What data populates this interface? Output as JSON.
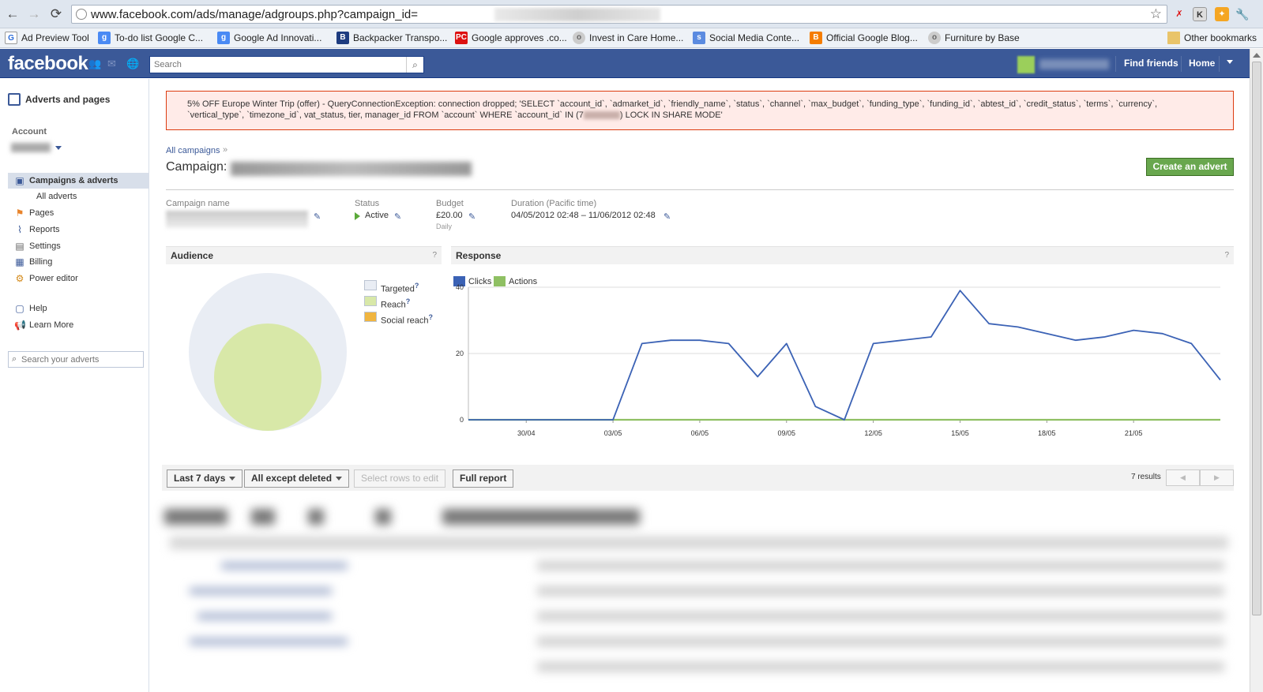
{
  "browser": {
    "back": "←",
    "forward": "→",
    "reload": "⟳",
    "url": "www.facebook.com/ads/manage/adgroups.php?campaign_id=",
    "bookmarks": [
      {
        "label": "Ad Preview Tool",
        "icon": "G"
      },
      {
        "label": "To-do list Google C...",
        "icon": "g"
      },
      {
        "label": "Google Ad Innovati...",
        "icon": "g"
      },
      {
        "label": "Backpacker Transpo...",
        "icon": "B"
      },
      {
        "label": "Google approves .co...",
        "icon": "PC"
      },
      {
        "label": "Invest in Care Home...",
        "icon": "o"
      },
      {
        "label": "Social Media Conte...",
        "icon": "s"
      },
      {
        "label": "Official Google Blog...",
        "icon": "B"
      },
      {
        "label": "Furniture by Base",
        "icon": "o"
      }
    ],
    "other_bookmarks": "Other bookmarks"
  },
  "header": {
    "logo": "facebook",
    "search_placeholder": "Search",
    "find_friends": "Find friends",
    "home": "Home"
  },
  "sidebar": {
    "title": "Adverts and pages",
    "account_label": "Account",
    "items": [
      {
        "label": "Campaigns & adverts",
        "icon": "campaigns-icon"
      },
      {
        "label": "All adverts",
        "icon": ""
      },
      {
        "label": "Pages",
        "icon": "flag-icon"
      },
      {
        "label": "Reports",
        "icon": "reports-icon"
      },
      {
        "label": "Settings",
        "icon": "settings-icon"
      },
      {
        "label": "Billing",
        "icon": "billing-icon"
      },
      {
        "label": "Power editor",
        "icon": "power-editor-icon"
      },
      {
        "label": "Help",
        "icon": "help-icon"
      },
      {
        "label": "Learn More",
        "icon": "megaphone-icon"
      }
    ],
    "search_placeholder": "Search your adverts"
  },
  "error": {
    "text": "5% OFF Europe Winter Trip (offer) - QueryConnectionException: connection dropped; 'SELECT `account_id`, `admarket_id`, `friendly_name`, `status`, `channel`, `max_budget`, `funding_type`, `funding_id`, `abtest_id`, `credit_status`, `terms`, `currency`, `vertical_type`, `timezone_id`, vat_status, tier, manager_id FROM `account` WHERE `account_id` IN (7",
    "text_end": ") LOCK IN SHARE MODE'"
  },
  "campaign": {
    "breadcrumb": "All campaigns",
    "breadcrumb_sep": "»",
    "title_prefix": "Campaign:",
    "create_button": "Create an advert",
    "name_label": "Campaign name",
    "status_label": "Status",
    "status_value": "Active",
    "budget_label": "Budget",
    "budget_value": "£20.00",
    "budget_period": "Daily",
    "duration_label": "Duration (Pacific time)",
    "duration_value": "04/05/2012 02:48 – 11/06/2012 02:48"
  },
  "audience": {
    "title": "Audience",
    "help": "?",
    "legend": [
      {
        "label": "Targeted",
        "color": "#e9edf4"
      },
      {
        "label": "Reach",
        "color": "#d8e8a8"
      },
      {
        "label": "Social reach",
        "color": "#f0b540"
      }
    ]
  },
  "response": {
    "title": "Response",
    "help": "?"
  },
  "chart_data": {
    "type": "line",
    "x": [
      "28/04",
      "29/04",
      "30/04",
      "01/05",
      "02/05",
      "03/05",
      "04/05",
      "05/05",
      "06/05",
      "07/05",
      "08/05",
      "09/05",
      "10/05",
      "11/05",
      "12/05",
      "13/05",
      "14/05",
      "15/05",
      "16/05",
      "17/05",
      "18/05",
      "19/05",
      "20/05",
      "21/05",
      "22/05",
      "23/05",
      "24/05"
    ],
    "x_tick_labels": [
      "30/04",
      "03/05",
      "06/05",
      "09/05",
      "12/05",
      "15/05",
      "18/05",
      "21/05"
    ],
    "series": [
      {
        "name": "Clicks",
        "color": "#3b62b5",
        "values": [
          0,
          0,
          0,
          0,
          0,
          0,
          23,
          24,
          24,
          23,
          13,
          23,
          4,
          0,
          23,
          24,
          25,
          39,
          29,
          28,
          26,
          24,
          25,
          27,
          26,
          23,
          12
        ]
      },
      {
        "name": "Actions",
        "color": "#8fc063",
        "values": [
          0,
          0,
          0,
          0,
          0,
          0,
          0,
          0,
          0,
          0,
          0,
          0,
          0,
          0,
          0,
          0,
          0,
          0,
          0,
          0,
          0,
          0,
          0,
          0,
          0,
          0,
          0
        ]
      }
    ],
    "y_ticks": [
      0,
      20,
      40
    ],
    "ylim": [
      0,
      40
    ],
    "grid": true,
    "legend": "top-left"
  },
  "toolbar": {
    "date_range": "Last 7 days",
    "filter": "All except deleted",
    "select_rows": "Select rows to edit",
    "full_report": "Full report",
    "results": "7 results",
    "prev": "◀",
    "next": "▶"
  }
}
